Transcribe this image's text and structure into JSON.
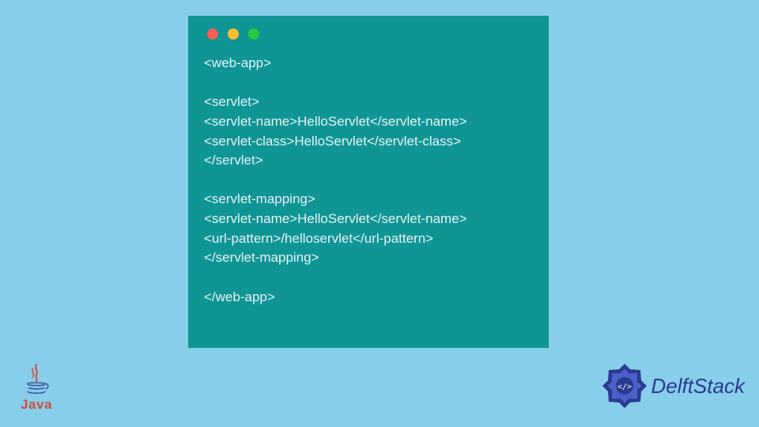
{
  "code_lines": [
    "<web-app>",
    "",
    "<servlet>",
    "<servlet-name>HelloServlet</servlet-name>",
    "<servlet-class>HelloServlet</servlet-class>",
    "</servlet>",
    "",
    "<servlet-mapping>",
    "<servlet-name>HelloServlet</servlet-name>",
    "<url-pattern>/helloservlet</url-pattern>",
    "</servlet-mapping>",
    "",
    "</web-app>"
  ],
  "logos": {
    "java_label": "Java",
    "delftstack_label": "DelftStack"
  },
  "window": {
    "dots": [
      "red",
      "yellow",
      "green"
    ]
  }
}
